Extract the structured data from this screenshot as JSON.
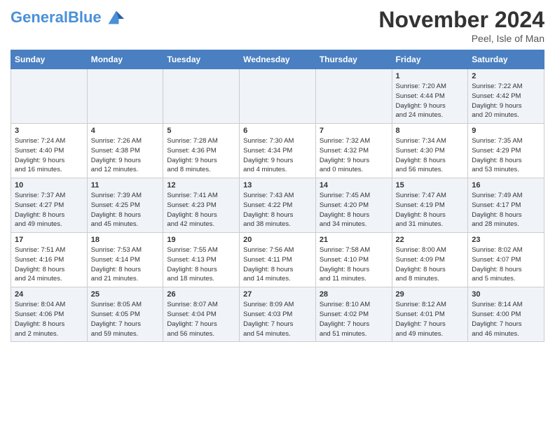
{
  "logo": {
    "line1": "General",
    "line2": "Blue"
  },
  "title": "November 2024",
  "subtitle": "Peel, Isle of Man",
  "days_header": [
    "Sunday",
    "Monday",
    "Tuesday",
    "Wednesday",
    "Thursday",
    "Friday",
    "Saturday"
  ],
  "weeks": [
    [
      {
        "day": "",
        "info": ""
      },
      {
        "day": "",
        "info": ""
      },
      {
        "day": "",
        "info": ""
      },
      {
        "day": "",
        "info": ""
      },
      {
        "day": "",
        "info": ""
      },
      {
        "day": "1",
        "info": "Sunrise: 7:20 AM\nSunset: 4:44 PM\nDaylight: 9 hours\nand 24 minutes."
      },
      {
        "day": "2",
        "info": "Sunrise: 7:22 AM\nSunset: 4:42 PM\nDaylight: 9 hours\nand 20 minutes."
      }
    ],
    [
      {
        "day": "3",
        "info": "Sunrise: 7:24 AM\nSunset: 4:40 PM\nDaylight: 9 hours\nand 16 minutes."
      },
      {
        "day": "4",
        "info": "Sunrise: 7:26 AM\nSunset: 4:38 PM\nDaylight: 9 hours\nand 12 minutes."
      },
      {
        "day": "5",
        "info": "Sunrise: 7:28 AM\nSunset: 4:36 PM\nDaylight: 9 hours\nand 8 minutes."
      },
      {
        "day": "6",
        "info": "Sunrise: 7:30 AM\nSunset: 4:34 PM\nDaylight: 9 hours\nand 4 minutes."
      },
      {
        "day": "7",
        "info": "Sunrise: 7:32 AM\nSunset: 4:32 PM\nDaylight: 9 hours\nand 0 minutes."
      },
      {
        "day": "8",
        "info": "Sunrise: 7:34 AM\nSunset: 4:30 PM\nDaylight: 8 hours\nand 56 minutes."
      },
      {
        "day": "9",
        "info": "Sunrise: 7:35 AM\nSunset: 4:29 PM\nDaylight: 8 hours\nand 53 minutes."
      }
    ],
    [
      {
        "day": "10",
        "info": "Sunrise: 7:37 AM\nSunset: 4:27 PM\nDaylight: 8 hours\nand 49 minutes."
      },
      {
        "day": "11",
        "info": "Sunrise: 7:39 AM\nSunset: 4:25 PM\nDaylight: 8 hours\nand 45 minutes."
      },
      {
        "day": "12",
        "info": "Sunrise: 7:41 AM\nSunset: 4:23 PM\nDaylight: 8 hours\nand 42 minutes."
      },
      {
        "day": "13",
        "info": "Sunrise: 7:43 AM\nSunset: 4:22 PM\nDaylight: 8 hours\nand 38 minutes."
      },
      {
        "day": "14",
        "info": "Sunrise: 7:45 AM\nSunset: 4:20 PM\nDaylight: 8 hours\nand 34 minutes."
      },
      {
        "day": "15",
        "info": "Sunrise: 7:47 AM\nSunset: 4:19 PM\nDaylight: 8 hours\nand 31 minutes."
      },
      {
        "day": "16",
        "info": "Sunrise: 7:49 AM\nSunset: 4:17 PM\nDaylight: 8 hours\nand 28 minutes."
      }
    ],
    [
      {
        "day": "17",
        "info": "Sunrise: 7:51 AM\nSunset: 4:16 PM\nDaylight: 8 hours\nand 24 minutes."
      },
      {
        "day": "18",
        "info": "Sunrise: 7:53 AM\nSunset: 4:14 PM\nDaylight: 8 hours\nand 21 minutes."
      },
      {
        "day": "19",
        "info": "Sunrise: 7:55 AM\nSunset: 4:13 PM\nDaylight: 8 hours\nand 18 minutes."
      },
      {
        "day": "20",
        "info": "Sunrise: 7:56 AM\nSunset: 4:11 PM\nDaylight: 8 hours\nand 14 minutes."
      },
      {
        "day": "21",
        "info": "Sunrise: 7:58 AM\nSunset: 4:10 PM\nDaylight: 8 hours\nand 11 minutes."
      },
      {
        "day": "22",
        "info": "Sunrise: 8:00 AM\nSunset: 4:09 PM\nDaylight: 8 hours\nand 8 minutes."
      },
      {
        "day": "23",
        "info": "Sunrise: 8:02 AM\nSunset: 4:07 PM\nDaylight: 8 hours\nand 5 minutes."
      }
    ],
    [
      {
        "day": "24",
        "info": "Sunrise: 8:04 AM\nSunset: 4:06 PM\nDaylight: 8 hours\nand 2 minutes."
      },
      {
        "day": "25",
        "info": "Sunrise: 8:05 AM\nSunset: 4:05 PM\nDaylight: 7 hours\nand 59 minutes."
      },
      {
        "day": "26",
        "info": "Sunrise: 8:07 AM\nSunset: 4:04 PM\nDaylight: 7 hours\nand 56 minutes."
      },
      {
        "day": "27",
        "info": "Sunrise: 8:09 AM\nSunset: 4:03 PM\nDaylight: 7 hours\nand 54 minutes."
      },
      {
        "day": "28",
        "info": "Sunrise: 8:10 AM\nSunset: 4:02 PM\nDaylight: 7 hours\nand 51 minutes."
      },
      {
        "day": "29",
        "info": "Sunrise: 8:12 AM\nSunset: 4:01 PM\nDaylight: 7 hours\nand 49 minutes."
      },
      {
        "day": "30",
        "info": "Sunrise: 8:14 AM\nSunset: 4:00 PM\nDaylight: 7 hours\nand 46 minutes."
      }
    ]
  ],
  "colors": {
    "header_bg": "#4a7fc1",
    "odd_row": "#f0f4f8",
    "even_row": "#ffffff"
  }
}
